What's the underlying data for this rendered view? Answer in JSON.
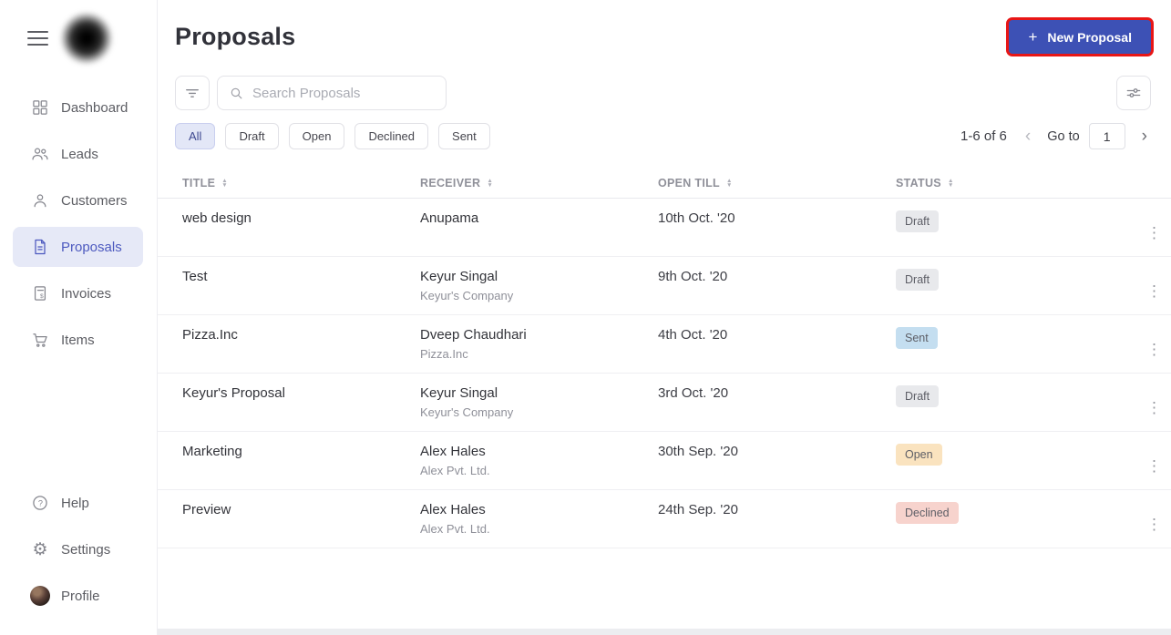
{
  "sidebar": {
    "items": [
      {
        "label": "Dashboard"
      },
      {
        "label": "Leads"
      },
      {
        "label": "Customers"
      },
      {
        "label": "Proposals"
      },
      {
        "label": "Invoices"
      },
      {
        "label": "Items"
      }
    ],
    "footer_items": [
      {
        "label": "Help"
      },
      {
        "label": "Settings"
      },
      {
        "label": "Profile"
      }
    ]
  },
  "header": {
    "title": "Proposals",
    "new_proposal_label": "New Proposal",
    "plus_glyph": "+"
  },
  "toolbar": {
    "search_placeholder": "Search Proposals"
  },
  "filters": {
    "chips": [
      {
        "label": "All"
      },
      {
        "label": "Draft"
      },
      {
        "label": "Open"
      },
      {
        "label": "Declined"
      },
      {
        "label": "Sent"
      }
    ]
  },
  "pagination": {
    "range": "1-6 of 6",
    "prev_glyph": "‹",
    "goto_label": "Go to",
    "page": "1",
    "next_glyph": "›"
  },
  "table": {
    "columns": [
      "TITLE",
      "RECEIVER",
      "OPEN TILL",
      "STATUS"
    ],
    "rows": [
      {
        "title": "web design",
        "receiver": "Anupama",
        "company": "",
        "open_till": "10th Oct. '20",
        "status": "Draft"
      },
      {
        "title": "Test",
        "receiver": "Keyur Singal",
        "company": "Keyur's Company",
        "open_till": "9th Oct. '20",
        "status": "Draft"
      },
      {
        "title": "Pizza.Inc",
        "receiver": "Dveep Chaudhari",
        "company": "Pizza.Inc",
        "open_till": "4th Oct. '20",
        "status": "Sent"
      },
      {
        "title": "Keyur's Proposal",
        "receiver": "Keyur Singal",
        "company": "Keyur's Company",
        "open_till": "3rd Oct. '20",
        "status": "Draft"
      },
      {
        "title": "Marketing",
        "receiver": "Alex Hales",
        "company": "Alex Pvt. Ltd.",
        "open_till": "30th Sep. '20",
        "status": "Open"
      },
      {
        "title": "Preview",
        "receiver": "Alex Hales",
        "company": "Alex Pvt. Ltd.",
        "open_till": "24th Sep. '20",
        "status": "Declined"
      }
    ]
  },
  "icons": {
    "sort_up": "▲",
    "sort_down": "▼",
    "kebab": "⋮",
    "gear": "⚙"
  },
  "colors": {
    "accent": "#3d51b5",
    "highlight_border": "#e81616",
    "active_nav_bg": "#e6e9f7",
    "badge_draft": "#e8e9ec",
    "badge_sent": "#c4def0",
    "badge_open": "#fae3bf",
    "badge_declined": "#f7d3cd"
  }
}
